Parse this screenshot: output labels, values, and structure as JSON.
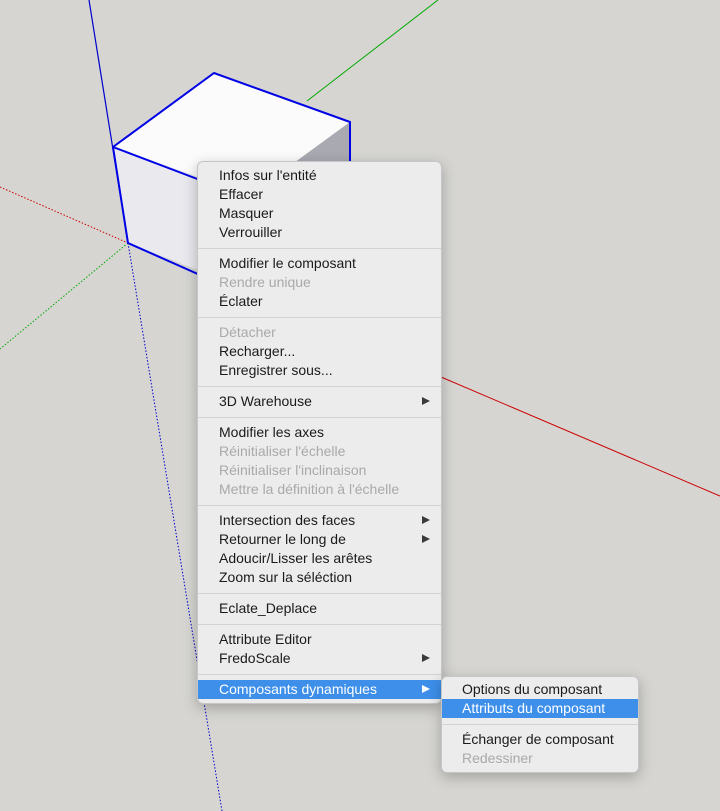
{
  "context_menu": {
    "items": [
      {
        "label": "Infos sur l'entité",
        "enabled": true
      },
      {
        "label": "Effacer",
        "enabled": true
      },
      {
        "label": "Masquer",
        "enabled": true
      },
      {
        "label": "Verrouiller",
        "enabled": true
      },
      {
        "label": "Modifier le composant",
        "enabled": true
      },
      {
        "label": "Rendre unique",
        "enabled": false
      },
      {
        "label": "Éclater",
        "enabled": true
      },
      {
        "label": "Détacher",
        "enabled": false
      },
      {
        "label": "Recharger...",
        "enabled": true
      },
      {
        "label": "Enregistrer sous...",
        "enabled": true
      },
      {
        "label": "3D Warehouse",
        "enabled": true,
        "submenu": true
      },
      {
        "label": "Modifier les axes",
        "enabled": true
      },
      {
        "label": "Réinitialiser l'échelle",
        "enabled": false
      },
      {
        "label": "Réinitialiser l'inclinaison",
        "enabled": false
      },
      {
        "label": "Mettre la définition à l'échelle",
        "enabled": false
      },
      {
        "label": "Intersection des faces",
        "enabled": true,
        "submenu": true
      },
      {
        "label": "Retourner le long de",
        "enabled": true,
        "submenu": true
      },
      {
        "label": "Adoucir/Lisser les arêtes",
        "enabled": true
      },
      {
        "label": "Zoom sur la séléction",
        "enabled": true
      },
      {
        "label": "Eclate_Deplace",
        "enabled": true
      },
      {
        "label": "Attribute Editor",
        "enabled": true
      },
      {
        "label": "FredoScale",
        "enabled": true,
        "submenu": true
      },
      {
        "label": "Composants dynamiques",
        "enabled": true,
        "submenu": true,
        "highlighted": true
      }
    ]
  },
  "submenu": {
    "items": [
      {
        "label": "Options du composant",
        "enabled": true
      },
      {
        "label": "Attributs du composant",
        "enabled": true,
        "highlighted": true
      },
      {
        "label": "Échanger de composant",
        "enabled": true
      },
      {
        "label": "Redessiner",
        "enabled": false
      }
    ]
  },
  "colors": {
    "canvas": "#d6d5d2",
    "selection_edge": "#0000e6",
    "axis_red": "#cc0000",
    "axis_green": "#00aa00",
    "axis_blue": "#0000cc",
    "menu_highlight": "#3d8fea"
  }
}
